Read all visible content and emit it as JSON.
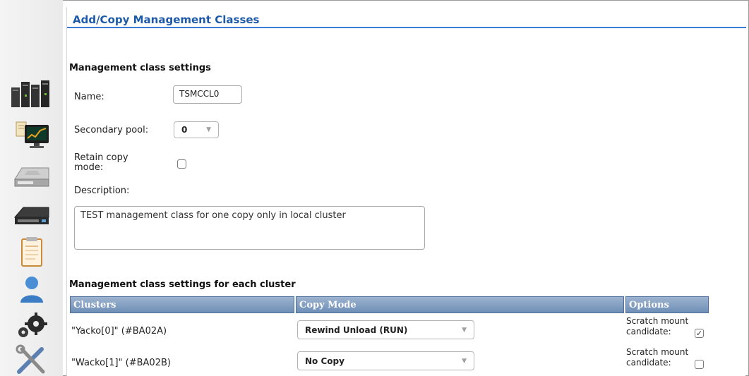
{
  "title": "Add/Copy Management Classes",
  "settings": {
    "heading": "Management class settings",
    "name_label": "Name:",
    "name_value": "TSMCCL0",
    "secondary_pool_label": "Secondary pool:",
    "secondary_pool_value": "0",
    "retain_label_line1": "Retain copy",
    "retain_label_line2": "mode:",
    "retain_checked": false,
    "description_label": "Description:",
    "description_value": "TEST management class for one copy only in local cluster"
  },
  "cluster_settings": {
    "heading": "Management class settings for each cluster",
    "columns": [
      "Clusters",
      "Copy Mode",
      "Options"
    ],
    "rows": [
      {
        "cluster": "\"Yacko[0]\" (#BA02A)",
        "copy_mode": "Rewind Unload (RUN)",
        "option_line1": "Scratch mount",
        "option_line2": "candidate:",
        "scratch_checked": true
      },
      {
        "cluster": "\"Wacko[1]\" (#BA02B)",
        "copy_mode": "No Copy",
        "option_line1": "Scratch mount",
        "option_line2": "candidate:",
        "scratch_checked": false
      }
    ]
  },
  "nav_icons": [
    "server-rack-icon",
    "monitor-chart-icon",
    "storage-drive-icon",
    "tape-drive-icon",
    "clipboard-icon",
    "user-icon",
    "gears-icon",
    "tools-icon"
  ],
  "colors": {
    "title": "#1d5aa8",
    "accent_line": "#3a7bd5",
    "table_header": "#7f9cc1"
  }
}
